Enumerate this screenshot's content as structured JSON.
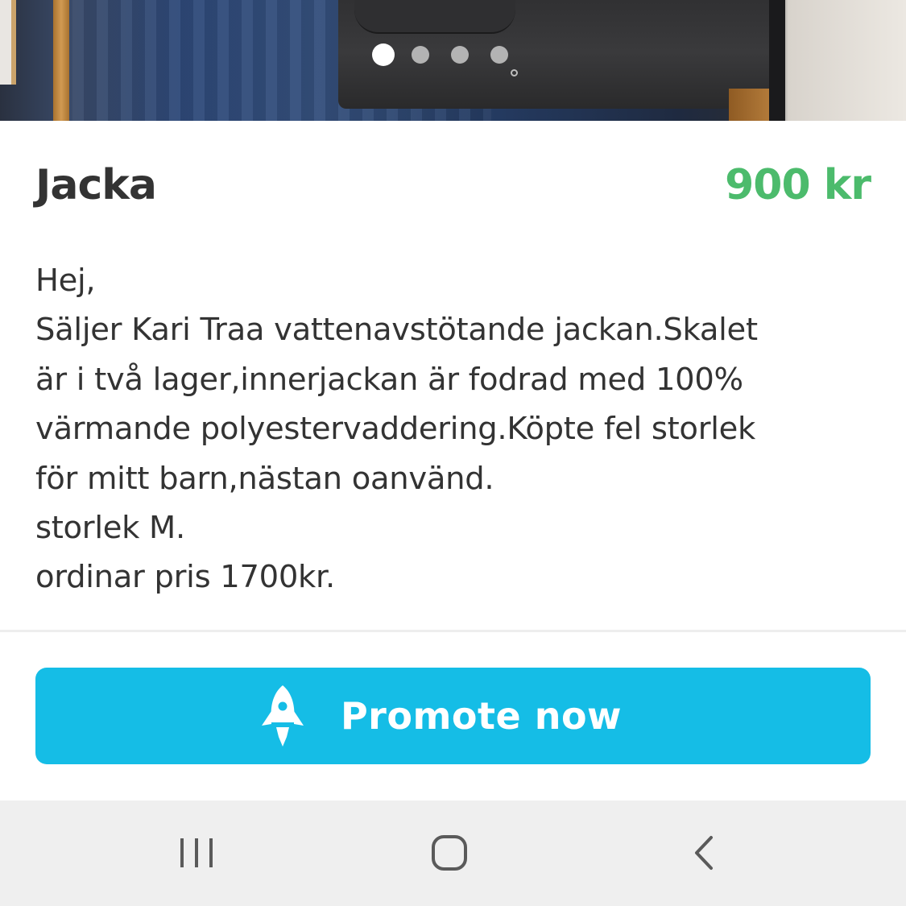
{
  "listing": {
    "title": "Jacka",
    "price": "900 kr",
    "description_lines": [
      "Hej,",
      "Säljer Kari Traa vattenavstötande jackan.Skalet",
      "är i två lager,innerjackan är fodrad med 100%",
      "värmande polyestervaddering.Köpte fel storlek",
      "för mitt barn,nästan oanvänd.",
      "storlek M.",
      "ordinar pris 1700kr."
    ]
  },
  "carousel": {
    "total_images": 4,
    "active_index": 0
  },
  "promote": {
    "label": "Promote now",
    "icon": "rocket-icon"
  },
  "navbar": {
    "recent_icon": "recent-apps-icon",
    "home_icon": "home-icon",
    "back_icon": "back-icon"
  },
  "colors": {
    "price": "#4cbb6c",
    "promote_button": "#15bde6",
    "text": "#333333",
    "navbar": "#efefef"
  }
}
